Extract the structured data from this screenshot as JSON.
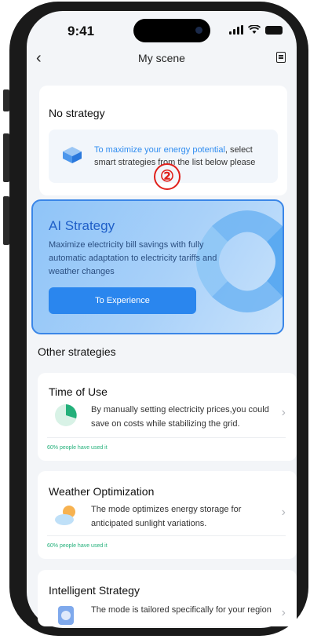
{
  "status_bar": {
    "time": "9:41"
  },
  "header": {
    "title": "My scene",
    "back_icon": "chevron-left-icon",
    "menu_icon": "list-icon"
  },
  "no_strategy": {
    "heading": "No strategy",
    "hint_highlight": "To maximize your energy potential",
    "hint_rest": ", select smart strategies from the list below please"
  },
  "marker": "②",
  "ai_strategy": {
    "title": "AI Strategy",
    "description": "Maximize electricity bill savings with fully automatic adaptation to electricity tariffs and weather changes",
    "button": "To Experience"
  },
  "other_strategies": {
    "title": "Other strategies",
    "items": [
      {
        "name": "Time of Use",
        "description": "By manually setting electricity prices,you could save on costs while stabilizing the grid.",
        "usage": "60% people have used it",
        "icon": "pie-chart-icon"
      },
      {
        "name": "Weather Optimization",
        "description": "The mode optimizes energy storage for anticipated sunlight variations.",
        "usage": "60% people have used it",
        "icon": "sun-cloud-icon"
      },
      {
        "name": "Intelligent Strategy",
        "description": "The mode is tailored specifically for your region",
        "icon": "intelligent-icon"
      }
    ]
  },
  "colors": {
    "accent": "#2a86ee",
    "highlight": "#2f8cf0",
    "usage_green": "#23b07a",
    "marker_red": "#e0201b"
  }
}
